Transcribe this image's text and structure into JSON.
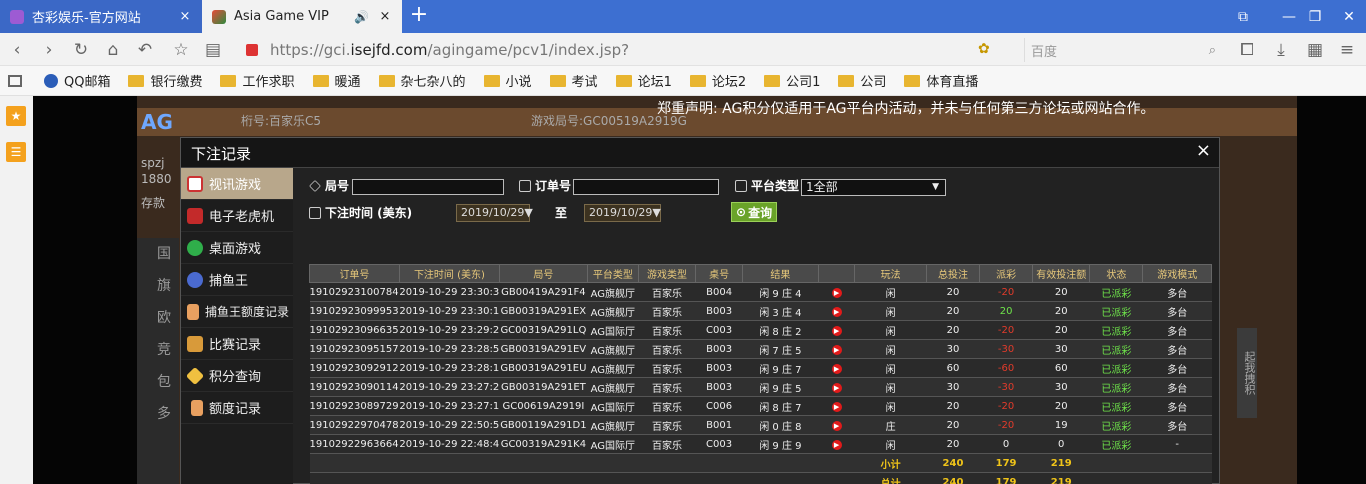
{
  "browser": {
    "tabs": [
      {
        "title": "杏彩娱乐-官方网站",
        "close": "×"
      },
      {
        "title": "Asia Game VIP",
        "close": "×"
      }
    ],
    "new_tab": "+",
    "window_controls": [
      "⧉",
      "—",
      "❐",
      "✕"
    ],
    "url_prefix": "https://gci.",
    "url_domain": "isejfd.com",
    "url_path": "/agingame/pcv1/index.jsp?",
    "search_placeholder": "百度",
    "bookmarks": [
      "QQ邮箱",
      "银行缴费",
      "工作求职",
      "暖通",
      "杂七杂八的",
      "小说",
      "考试",
      "论坛1",
      "论坛2",
      "公司1",
      "公司",
      "体育直播"
    ]
  },
  "page": {
    "disclaimer": "郑重声明: AG积分仅适用于AG平台内活动，并未与任何第三方论坛或网站合作。",
    "bg_table": "桁号:百家乐C5",
    "bg_round": "游戏局号:GC00519A2919G",
    "bg_user": "spzj",
    "bg_balance": "1880",
    "bg_deposit": "存款",
    "bg_menu": [
      "国",
      "旗",
      "欧",
      "竞",
      "包",
      "多"
    ],
    "bg_side": "起我拽积"
  },
  "dialog": {
    "title": "下注记录",
    "close": "×",
    "menu": [
      {
        "label": "视讯游戏",
        "icon": "cards-icon",
        "active": true
      },
      {
        "label": "电子老虎机",
        "icon": "slot-icon"
      },
      {
        "label": "桌面游戏",
        "icon": "chips-icon"
      },
      {
        "label": "捕鱼王",
        "icon": "fish-icon"
      },
      {
        "label": "捕鱼王额度记录",
        "icon": "doc-icon"
      },
      {
        "label": "比赛记录",
        "icon": "tag-icon"
      },
      {
        "label": "积分查询",
        "icon": "diamond-icon"
      },
      {
        "label": "额度记录",
        "icon": "doc-icon"
      }
    ],
    "filters": {
      "round_label": "局号",
      "order_label": "订单号",
      "platform_label": "平台类型",
      "platform_value": "1全部",
      "bet_time_label": "下注时间 (美东)",
      "date_from": "2019/10/29▼",
      "to_label": "至",
      "date_to": "2019/10/29▼",
      "query_button": "查询"
    },
    "table": {
      "headers": [
        "订单号",
        "下注时间 (美东)",
        "局号",
        "平台类型",
        "游戏类型",
        "桌号",
        "结果",
        "",
        "玩法",
        "总投注",
        "派彩",
        "有效投注额",
        "状态",
        "游戏模式"
      ],
      "rows": [
        [
          "191029231007844",
          "2019-10-29 23:30:38",
          "GB00419A291F4",
          "AG旗舰厅",
          "百家乐",
          "B004",
          "闲 9 庄 4",
          "闲",
          "20",
          "-20",
          "20",
          "已派彩",
          "多台"
        ],
        [
          "191029230999530",
          "2019-10-29 23:30:19",
          "GB00319A291EX",
          "AG旗舰厅",
          "百家乐",
          "B003",
          "闲 3 庄 4",
          "闲",
          "20",
          "20",
          "20",
          "已派彩",
          "多台"
        ],
        [
          "191029230966350",
          "2019-10-29 23:29:21",
          "GC00319A291LQ",
          "AG国际厅",
          "百家乐",
          "C003",
          "闲 8 庄 2",
          "闲",
          "20",
          "-20",
          "20",
          "已派彩",
          "多台"
        ],
        [
          "191029230951571",
          "2019-10-29 23:28:52",
          "GB00319A291EV",
          "AG旗舰厅",
          "百家乐",
          "B003",
          "闲 7 庄 5",
          "闲",
          "30",
          "-30",
          "30",
          "已派彩",
          "多台"
        ],
        [
          "191029230929128",
          "2019-10-29 23:28:16",
          "GB00319A291EU",
          "AG旗舰厅",
          "百家乐",
          "B003",
          "闲 9 庄 7",
          "闲",
          "60",
          "-60",
          "60",
          "已派彩",
          "多台"
        ],
        [
          "191029230901146",
          "2019-10-29 23:27:27",
          "GB00319A291ET",
          "AG旗舰厅",
          "百家乐",
          "B003",
          "闲 9 庄 5",
          "闲",
          "30",
          "-30",
          "30",
          "已派彩",
          "多台"
        ],
        [
          "191029230897292",
          "2019-10-29 23:27:15",
          "GC00619A2919I",
          "AG国际厅",
          "百家乐",
          "C006",
          "闲 8 庄 7",
          "闲",
          "20",
          "-20",
          "20",
          "已派彩",
          "多台"
        ],
        [
          "191029229704787",
          "2019-10-29 22:50:59",
          "GB00119A291D1",
          "AG旗舰厅",
          "百家乐",
          "B001",
          "闲 0 庄 8",
          "庄",
          "20",
          "-20",
          "19",
          "已派彩",
          "多台"
        ],
        [
          "191029229636649",
          "2019-10-29 22:48:47",
          "GC00319A291K4",
          "AG国际厅",
          "百家乐",
          "C003",
          "闲 9 庄 9",
          "闲",
          "20",
          "0",
          "0",
          "已派彩",
          "-"
        ]
      ],
      "subtotal": {
        "label": "小计",
        "bet": "240",
        "payout": "179",
        "valid": "219"
      },
      "total": {
        "label": "总计",
        "bet": "240",
        "payout": "179",
        "valid": "219"
      }
    }
  }
}
